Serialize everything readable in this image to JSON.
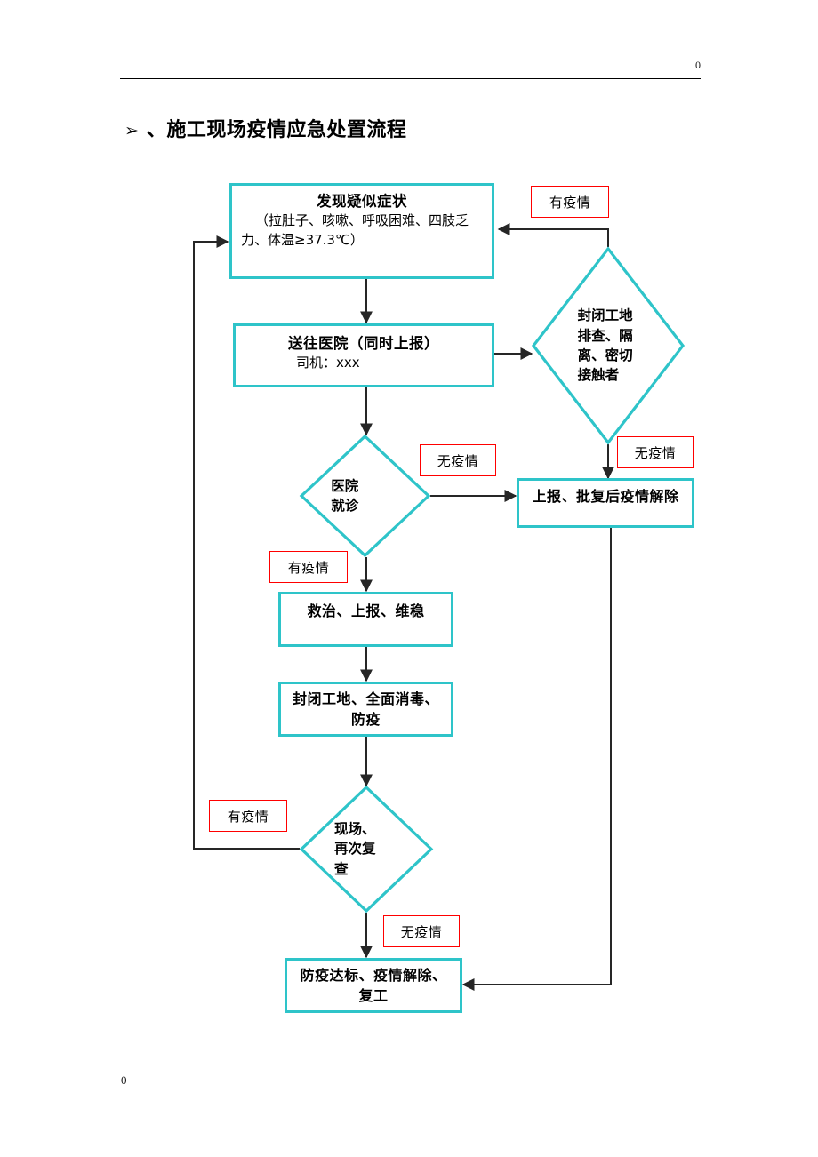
{
  "page": {
    "header_number": "0",
    "footer_number": "0"
  },
  "title": {
    "bullet": "➢",
    "text": "、施工现场疫情应急处置流程"
  },
  "flowchart": {
    "type": "flowchart",
    "node_border_color": "#2ec4c9",
    "label_border_color": "#ff0000",
    "connector_color": "#262626",
    "nodes": [
      {
        "id": "symptom",
        "shape": "process",
        "lines": [
          "发现疑似症状",
          "（拉肚子、咳嗽、呼吸困难、四肢乏",
          "力、体温≥37.3℃）"
        ]
      },
      {
        "id": "hospital-transfer",
        "shape": "process",
        "lines": [
          "送往医院（同时上报）",
          "司机：xxx"
        ]
      },
      {
        "id": "hospital-visit",
        "shape": "decision",
        "lines": [
          "医院",
          "就诊"
        ]
      },
      {
        "id": "lockdown-screen",
        "shape": "decision",
        "lines": [
          "封闭工地",
          "排查、隔",
          "离、密切",
          "接触者"
        ]
      },
      {
        "id": "report-release",
        "shape": "process",
        "lines": [
          "上报、批复后疫情解除"
        ]
      },
      {
        "id": "treat-report-stabilize",
        "shape": "process",
        "lines": [
          "救治、上报、维稳"
        ]
      },
      {
        "id": "lockdown-disinfect",
        "shape": "process",
        "lines": [
          "封闭工地、全面消毒、",
          "防疫"
        ]
      },
      {
        "id": "site-recheck",
        "shape": "decision",
        "lines": [
          "现场、",
          "再次复",
          "查"
        ]
      },
      {
        "id": "resume-work",
        "shape": "process",
        "lines": [
          "防疫达标、疫情解除、",
          "复工"
        ]
      }
    ],
    "edge_labels": [
      {
        "id": "label-epidemic-top",
        "text": "有疫情"
      },
      {
        "id": "label-no-epidemic-hospital",
        "text": "无疫情"
      },
      {
        "id": "label-no-epidemic-lockdown",
        "text": "无疫情"
      },
      {
        "id": "label-epidemic-hospital",
        "text": "有疫情"
      },
      {
        "id": "label-epidemic-recheck",
        "text": "有疫情"
      },
      {
        "id": "label-no-epidemic-recheck",
        "text": "无疫情"
      }
    ]
  }
}
